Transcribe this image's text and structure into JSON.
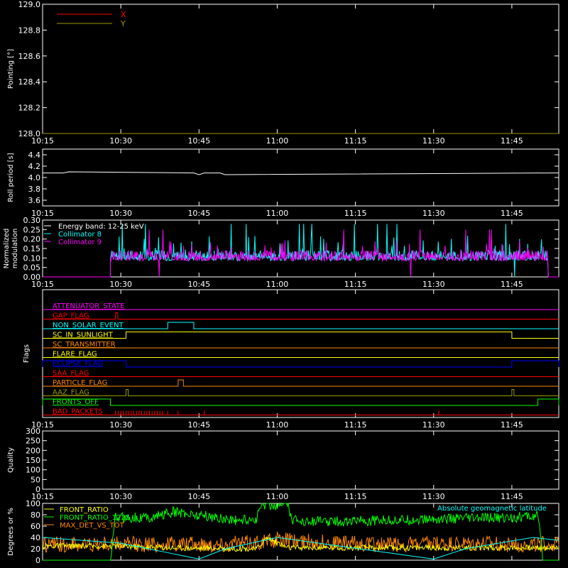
{
  "time_ticks": [
    "10:15",
    "10:30",
    "10:45",
    "11:00",
    "11:15",
    "11:30",
    "11:45"
  ],
  "colors": {
    "bg": "#000000",
    "axes": "#ffffff",
    "x": "#ff0000",
    "y": "#999900",
    "cyan": "#00ffff",
    "magenta": "#ff00ff",
    "green": "#00ff00",
    "orange": "#ff8800",
    "yellow": "#ffff00",
    "blue": "#0000ff"
  },
  "panels": {
    "pointing": {
      "ylabel": "Pointing [°]",
      "ticks": [
        "128.0",
        "128.2",
        "128.4",
        "128.6",
        "128.8",
        "129.0"
      ],
      "legend": [
        {
          "name": "X",
          "color": "#ff0000"
        },
        {
          "name": "Y",
          "color": "#999900"
        }
      ]
    },
    "roll": {
      "ylabel": "Roll period [s]",
      "ticks": [
        "3.6",
        "3.8",
        "4.0",
        "4.2",
        "4.4"
      ]
    },
    "modulation": {
      "ylabel_line1": "Normalized",
      "ylabel_line2": "modulation",
      "ticks": [
        "0.00",
        "0.05",
        "0.10",
        "0.15",
        "0.20",
        "0.25",
        "0.30"
      ],
      "legend": [
        {
          "name": "Energy band: 12-25 keV",
          "color": "#ffffff"
        },
        {
          "name": "Collimator 8",
          "color": "#00ffff"
        },
        {
          "name": "Collimator 9",
          "color": "#ff00ff"
        }
      ]
    },
    "flags": {
      "ylabel": "Flags",
      "items": [
        {
          "name": "ATTENUATOR_STATE",
          "color": "#ff00ff"
        },
        {
          "name": "GAP_FLAG",
          "color": "#ff0000"
        },
        {
          "name": "NON_SOLAR_EVENT",
          "color": "#00ffff"
        },
        {
          "name": "SC_IN_SUNLIGHT",
          "color": "#ffff00"
        },
        {
          "name": "SC_TRANSMITTER",
          "color": "#ff8800"
        },
        {
          "name": "FLARE_FLAG",
          "color": "#ffff00"
        },
        {
          "name": "ECLIPSE_FLAG",
          "color": "#0000ff"
        },
        {
          "name": "SAA_FLAG",
          "color": "#ff0000"
        },
        {
          "name": "PARTICLE_FLAG",
          "color": "#ff8800"
        },
        {
          "name": "AAZ_FLAG",
          "color": "#999900"
        },
        {
          "name": "FRONTS_OFF",
          "color": "#00ff00"
        },
        {
          "name": "BAD_PACKETS",
          "color": "#ff0000"
        }
      ]
    },
    "quality": {
      "ylabel": "Quality",
      "ticks": [
        "0",
        "50",
        "100",
        "150",
        "200",
        "250",
        "300"
      ]
    },
    "ratio": {
      "ylabel": "Degrees or %",
      "ticks": [
        "0",
        "20",
        "40",
        "60",
        "80",
        "100"
      ],
      "legend": [
        {
          "name": "FRONT_RATIO",
          "color": "#ffff00"
        },
        {
          "name": "FRONT_RATIO_1225",
          "color": "#00ff00"
        },
        {
          "name": "MAX_DET_VS_TOT",
          "color": "#ff8800"
        }
      ],
      "right_label": {
        "name": "Absolute geomagnetic latitude",
        "color": "#00ffff"
      }
    }
  },
  "chart_data": [
    {
      "type": "line",
      "panel": "pointing",
      "xlabel": "",
      "ylabel": "Pointing [°]",
      "x_range": [
        "10:15",
        "11:54"
      ],
      "ylim": [
        128.0,
        129.0
      ],
      "series": [
        {
          "name": "X",
          "x": [
            "10:15",
            "11:54"
          ],
          "values": [
            128.0,
            128.0
          ]
        },
        {
          "name": "Y",
          "x": [
            "10:15",
            "11:54"
          ],
          "values": [
            128.0,
            128.0
          ]
        }
      ]
    },
    {
      "type": "line",
      "panel": "roll",
      "xlabel": "",
      "ylabel": "Roll period [s]",
      "x_range": [
        "10:15",
        "11:54"
      ],
      "ylim": [
        3.5,
        4.5
      ],
      "series": [
        {
          "x": [
            "10:15",
            "10:19",
            "10:20",
            "10:44",
            "10:45",
            "10:46",
            "10:49",
            "10:50",
            "11:53",
            "11:54"
          ],
          "values": [
            4.08,
            4.08,
            4.1,
            4.08,
            4.05,
            4.08,
            4.08,
            4.05,
            4.08,
            4.08
          ]
        }
      ]
    },
    {
      "type": "line",
      "panel": "modulation",
      "xlabel": "",
      "ylabel": "Normalized modulation",
      "x_range": [
        "10:15",
        "11:54"
      ],
      "ylim": [
        0.0,
        0.3
      ],
      "note": "Energy band: 12-25 keV",
      "series": [
        {
          "name": "Collimator 8",
          "start": "10:28",
          "end": "11:52",
          "baseline": 0.1,
          "noise_max": 0.22,
          "peak": 0.28
        },
        {
          "name": "Collimator 9",
          "start": "10:28",
          "end": "11:52",
          "baseline": 0.1,
          "noise_max": 0.2,
          "peak": 0.25
        }
      ]
    },
    {
      "type": "line",
      "panel": "flags",
      "xlabel": "",
      "ylabel": "Flags",
      "x_range": [
        "10:15",
        "11:54"
      ],
      "series": [
        {
          "name": "ATTENUATOR_STATE",
          "segments": []
        },
        {
          "name": "GAP_FLAG",
          "segments": [
            [
              "10:29",
              "10:29"
            ]
          ]
        },
        {
          "name": "NON_SOLAR_EVENT",
          "segments": [
            [
              "10:39",
              "10:44"
            ]
          ]
        },
        {
          "name": "SC_IN_SUNLIGHT",
          "segments": [
            [
              "10:31",
              "11:45"
            ]
          ]
        },
        {
          "name": "SC_TRANSMITTER",
          "segments": []
        },
        {
          "name": "FLARE_FLAG",
          "segments": []
        },
        {
          "name": "ECLIPSE_FLAG",
          "segments": [
            [
              "10:15",
              "10:31"
            ],
            [
              "11:45",
              "11:54"
            ]
          ]
        },
        {
          "name": "SAA_FLAG",
          "segments": []
        },
        {
          "name": "PARTICLE_FLAG",
          "segments": [
            [
              "10:41",
              "10:42"
            ]
          ]
        },
        {
          "name": "AAZ_FLAG",
          "segments": [
            [
              "10:31",
              "10:31"
            ],
            [
              "11:45",
              "11:45"
            ]
          ]
        },
        {
          "name": "FRONTS_OFF",
          "segments": [
            [
              "10:15",
              "10:28"
            ],
            [
              "11:50",
              "11:54"
            ]
          ]
        },
        {
          "name": "BAD_PACKETS",
          "segments": [
            [
              "10:29",
              "10:38"
            ],
            [
              "10:39",
              "10:39"
            ],
            [
              "10:41",
              "10:41"
            ],
            [
              "10:46",
              "10:46"
            ],
            [
              "11:31",
              "11:31"
            ]
          ]
        }
      ]
    },
    {
      "type": "line",
      "panel": "quality",
      "xlabel": "",
      "ylabel": "Quality",
      "x_range": [
        "10:15",
        "11:54"
      ],
      "ylim": [
        0,
        300
      ],
      "series": []
    },
    {
      "type": "line",
      "panel": "ratio",
      "xlabel": "",
      "ylabel": "Degrees or %",
      "x_range": [
        "10:15",
        "11:54"
      ],
      "ylim": [
        0,
        100
      ],
      "series": [
        {
          "name": "FRONT_RATIO_1225",
          "x": [
            "10:15",
            "10:28",
            "10:29",
            "10:36",
            "10:40",
            "10:46",
            "10:52",
            "10:56",
            "10:57",
            "11:02",
            "11:03",
            "11:10",
            "11:30",
            "11:45",
            "11:50",
            "11:51",
            "11:54"
          ],
          "values": [
            0,
            0,
            75,
            75,
            85,
            78,
            70,
            72,
            98,
            98,
            70,
            68,
            72,
            75,
            78,
            0,
            0
          ]
        },
        {
          "name": "FRONT_RATIO",
          "x": [
            "10:15",
            "10:28",
            "10:40",
            "10:56",
            "10:58",
            "11:02",
            "11:30",
            "11:54"
          ],
          "values": [
            25,
            25,
            22,
            20,
            40,
            22,
            22,
            22
          ]
        },
        {
          "name": "MAX_DET_VS_TOT",
          "x": [
            "10:15",
            "10:30",
            "10:50",
            "11:00",
            "11:20",
            "11:45",
            "11:54"
          ],
          "values": [
            28,
            28,
            28,
            35,
            28,
            28,
            28
          ]
        },
        {
          "name": "Absolute geomagnetic latitude",
          "x": [
            "10:15",
            "10:30",
            "10:45",
            "10:50",
            "11:00",
            "11:30",
            "11:36",
            "11:49",
            "11:54"
          ],
          "values": [
            40,
            30,
            2,
            20,
            40,
            2,
            20,
            40,
            35
          ]
        }
      ]
    }
  ]
}
